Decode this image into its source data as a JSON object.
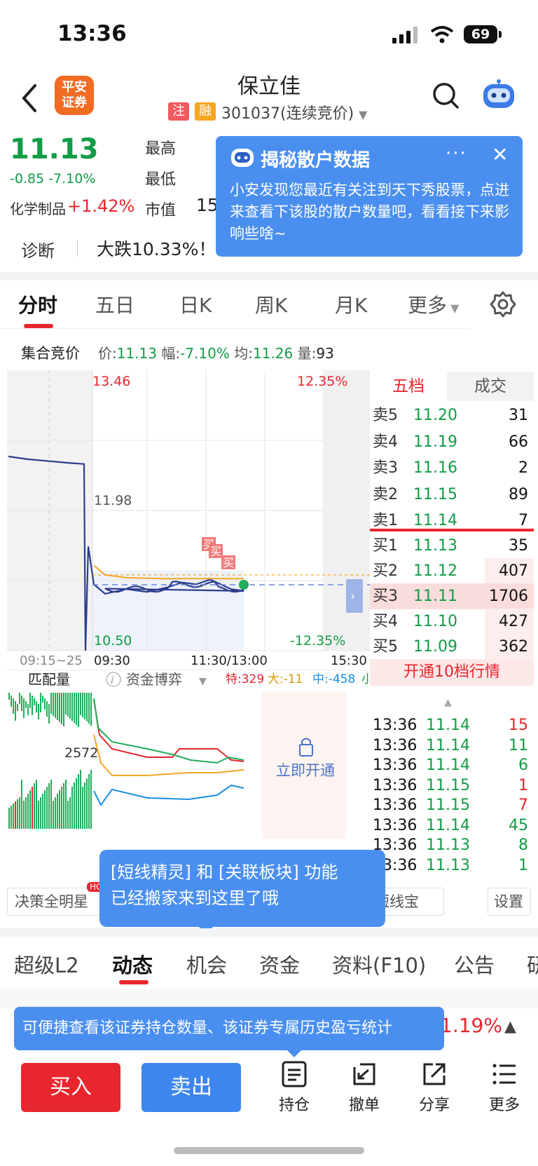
{
  "status": {
    "time": "13:36",
    "battery": "69"
  },
  "header": {
    "logo_text_1": "平安",
    "logo_text_2": "证券",
    "stock_name": "保立佳",
    "tag_zhu": "注",
    "tag_rong": "融",
    "stock_code": "301037(连续竞价)"
  },
  "quote": {
    "price": "11.13",
    "change": "-0.85 -7.10%",
    "sector_name": "化学制品",
    "sector_change": "+1.42%",
    "label_high": "最高",
    "label_low": "最低",
    "label_mktcap": "市值",
    "mktcap_value_partial": "15"
  },
  "popup": {
    "title": "揭秘散户数据",
    "more": "···",
    "close": "✕",
    "body": "小安发现您最近有关注到天下秀股票，点进来查看下该股的散户数量吧，看看接下来影响些啥~"
  },
  "diagnosis": {
    "label": "诊断",
    "text": "大跌10.33%！"
  },
  "chart_tabs": [
    "分时",
    "五日",
    "日K",
    "周K",
    "月K",
    "更多"
  ],
  "auction": {
    "label": "集合竞价",
    "price_label": "价:",
    "price": "11.13",
    "range_label": "幅:",
    "range": "-7.10%",
    "avg_label": "均:",
    "avg": "11.26",
    "vol_label": "量:",
    "vol": "93"
  },
  "chart_labels": {
    "top_price": "13.46",
    "top_pct": "12.35%",
    "mid_price": "11.98",
    "bottom_price": "10.50",
    "bottom_pct": "-12.35%",
    "time_pre": "09:15~25",
    "time_open": "09:30",
    "time_mid": "11:30/13:00",
    "time_close": "15:30",
    "buy_marker": "买",
    "sub_left_label": "匹配量",
    "sub_indicator": "资金博弈",
    "sub_te": "特:329",
    "sub_da": "大:-11",
    "sub_zhong": "中:-458",
    "sub_xiao": "小",
    "sub_value": "2572",
    "unlock_label": "立即开通"
  },
  "chart_data": {
    "type": "line",
    "title": "",
    "ylim": [
      10.5,
      13.46
    ],
    "reference": 11.98,
    "series": [
      {
        "name": "价",
        "values": [
          12.55,
          12.52,
          12.5,
          12.48,
          12.47,
          10.5,
          11.6,
          11.2,
          11.1,
          11.15,
          11.12,
          11.17,
          11.22,
          11.2,
          11.25,
          11.15,
          11.13
        ]
      },
      {
        "name": "均",
        "values": [
          11.4,
          11.3,
          11.27,
          11.26,
          11.26,
          11.26,
          11.26
        ]
      }
    ]
  },
  "order_book": {
    "tab_five": "五档",
    "tab_deal": "成交",
    "asks": [
      {
        "label": "卖5",
        "price": "11.20",
        "vol": "31"
      },
      {
        "label": "卖4",
        "price": "11.19",
        "vol": "66"
      },
      {
        "label": "卖3",
        "price": "11.16",
        "vol": "2"
      },
      {
        "label": "卖2",
        "price": "11.15",
        "vol": "89"
      },
      {
        "label": "卖1",
        "price": "11.14",
        "vol": "7"
      }
    ],
    "bids": [
      {
        "label": "买1",
        "price": "11.13",
        "vol": "35"
      },
      {
        "label": "买2",
        "price": "11.12",
        "vol": "407"
      },
      {
        "label": "买3",
        "price": "11.11",
        "vol": "1706"
      },
      {
        "label": "买4",
        "price": "11.10",
        "vol": "427"
      },
      {
        "label": "买5",
        "price": "11.09",
        "vol": "362"
      }
    ],
    "upgrade": "开通10档行情",
    "ticks": [
      {
        "time": "13:36",
        "price": "11.14",
        "vol": "15",
        "dir": "red"
      },
      {
        "time": "13:36",
        "price": "11.14",
        "vol": "11",
        "dir": "green"
      },
      {
        "time": "13:36",
        "price": "11.14",
        "vol": "6",
        "dir": "green"
      },
      {
        "time": "13:36",
        "price": "11.15",
        "vol": "1",
        "dir": "red"
      },
      {
        "time": "13:36",
        "price": "11.15",
        "vol": "7",
        "dir": "red"
      },
      {
        "time": "13:36",
        "price": "11.14",
        "vol": "45",
        "dir": "green"
      },
      {
        "time": "13:36",
        "price": "11.13",
        "vol": "8",
        "dir": "green"
      },
      {
        "time": "13:36",
        "price": "11.13",
        "vol": "1",
        "dir": "green"
      }
    ]
  },
  "tools": {
    "decision": "决策全明星",
    "hot": "HOT",
    "shortline": "短线宝",
    "settings": "设置"
  },
  "tooltip": {
    "text_1": "[短线精灵] 和 [关联板块] 功能",
    "text_2": "已经搬家来到这里了哦"
  },
  "bottom_tabs": [
    "超级L2",
    "动态",
    "机会",
    "资金",
    "资料(F10)",
    "公告",
    "研"
  ],
  "hint": {
    "text": "可便捷查看该证券持仓数量、该证券专属历史盈亏统计",
    "pct": "1.19%"
  },
  "actions": {
    "buy": "买入",
    "sell": "卖出",
    "hold": "持仓",
    "cancel": "撤单",
    "share": "分享",
    "more": "更多"
  }
}
